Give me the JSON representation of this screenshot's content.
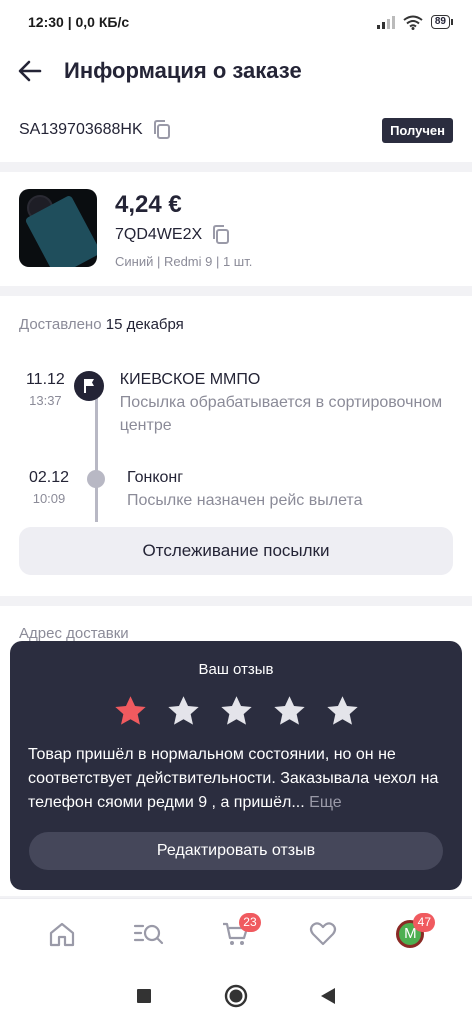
{
  "status_bar": {
    "time_text": "12:30 | 0,0 КБ/с",
    "battery": "89"
  },
  "header": {
    "title": "Информация о заказе"
  },
  "order": {
    "tracking_number": "SA139703688HK",
    "status": "Получен"
  },
  "product": {
    "price": "4,24 €",
    "sku": "7QD4WE2X",
    "attributes": "Синий | Redmi 9 | 1 шт."
  },
  "delivery": {
    "delivered_label": "Доставлено",
    "delivered_date": "15 декабря",
    "events": [
      {
        "day": "11.12",
        "time": "13:37",
        "place": "КИЕВСКОЕ ММПО",
        "description": "Посылка обрабатывается в сортировочном центре"
      },
      {
        "day": "02.12",
        "time": "10:09",
        "place": "Гонконг",
        "description": "Посылке назначен рейс вылета"
      }
    ],
    "track_button": "Отслеживание посылки"
  },
  "address": {
    "label": "Адрес доставки"
  },
  "review": {
    "title": "Ваш отзыв",
    "rating": 1,
    "max_rating": 5,
    "text": "Товар пришёл в нормальном состоянии, но он не соответствует действительности. Заказывала чехол на телефон  сяоми редми 9 , а пришёл...",
    "more_label": "Еще",
    "edit_button": "Редактировать отзыв",
    "star_active_color": "#f05a5f",
    "star_inactive_color": "#e4e4ea"
  },
  "tabbar": {
    "items": [
      {
        "name": "home-icon"
      },
      {
        "name": "catalog-search-icon"
      },
      {
        "name": "cart-icon",
        "badge": "23"
      },
      {
        "name": "heart-icon"
      },
      {
        "name": "profile-avatar",
        "avatar_letter": "M",
        "badge": "47"
      }
    ]
  },
  "colors": {
    "dark": "#2b2d3f",
    "accent_red": "#f05a5f",
    "muted_text": "#8b8b98"
  }
}
